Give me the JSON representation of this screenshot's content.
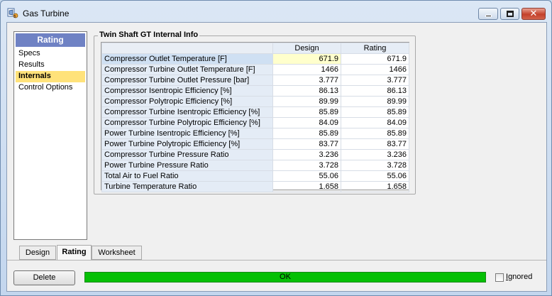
{
  "window": {
    "title": "Gas Turbine"
  },
  "nav": {
    "header": "Rating",
    "items": [
      "Specs",
      "Results",
      "Internals",
      "Control Options"
    ],
    "selected": "Internals"
  },
  "group": {
    "title": "Twin Shaft GT Internal Info"
  },
  "table": {
    "columns": [
      "Design",
      "Rating"
    ],
    "rows": [
      {
        "label": "Compressor Outlet Temperature [F]",
        "design": "671.9",
        "rating": "671.9"
      },
      {
        "label": "Compressor Turbine Outlet Temperature [F]",
        "design": "1466",
        "rating": "1466"
      },
      {
        "label": "Compressor Turbine Outlet Pressure [bar]",
        "design": "3.777",
        "rating": "3.777"
      },
      {
        "label": "Compressor Isentropic Efficiency [%]",
        "design": "86.13",
        "rating": "86.13"
      },
      {
        "label": "Compressor Polytropic Efficiency [%]",
        "design": "89.99",
        "rating": "89.99"
      },
      {
        "label": "Compressor Turbine Isentropic Efficiency [%]",
        "design": "85.89",
        "rating": "85.89"
      },
      {
        "label": "Compressor Turbine Polytropic Efficiency [%]",
        "design": "84.09",
        "rating": "84.09"
      },
      {
        "label": "Power Turbine Isentropic Efficiency [%]",
        "design": "85.89",
        "rating": "85.89"
      },
      {
        "label": "Power Turbine Polytropic Efficiency [%]",
        "design": "83.77",
        "rating": "83.77"
      },
      {
        "label": "Compressor Turbine Pressure Ratio",
        "design": "3.236",
        "rating": "3.236"
      },
      {
        "label": "Power Turbine Pressure Ratio",
        "design": "3.728",
        "rating": "3.728"
      },
      {
        "label": "Total Air to Fuel Ratio",
        "design": "55.06",
        "rating": "55.06"
      },
      {
        "label": "Turbine Temperature Ratio",
        "design": "1.658",
        "rating": "1.658"
      }
    ]
  },
  "tabs": [
    "Design",
    "Rating",
    "Worksheet"
  ],
  "active_tab": "Rating",
  "footer": {
    "delete_label": "Delete",
    "status_text": "OK",
    "status_color": "#05c005",
    "ignored_label_prefix": "",
    "ignored_label_underline": "I",
    "ignored_label_rest": "gnored",
    "ignored_checked": false
  },
  "icons": {
    "app": "gas-turbine-icon",
    "minimize": "minimize-icon",
    "maximize": "maximize-icon",
    "close": "close-icon"
  }
}
